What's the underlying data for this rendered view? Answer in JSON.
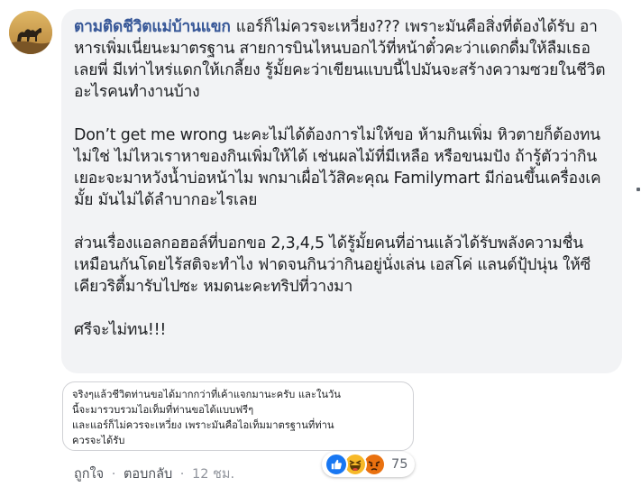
{
  "comment": {
    "author": "ตามติดชีวิตแม่บ้านแขก",
    "paragraphs": [
      "แอร์ก็ไม่ควรจะเหวี่ยง??? เพราะมันคือสิ่งที่ต้องได้รับ อาหารเพิ่มเนี่ยนะมาตรฐาน สายการบินไหนบอกไว้ที่หน้าตั๋วคะว่าแดกดื่มให้ลืมเธอเลยพี่ มีเท่าไหร่แดกให้เกลี้ยง รู้มั้ยคะว่าเขียนแบบนี้ไปมันจะสร้างความซวยในชีวิตอะไรคนทำงานบ้าง",
      "Don’t get me wrong นะคะไม่ได้ต้องการไม่ให้ขอ ห้ามกินเพิ่ม หิวตายก็ต้องทน ไม่ใช่ ไม่ไหวเราหาของกินเพิ่มให้ได้ เช่นผลไม้ที่มีเหลือ หรือขนมปัง ถ้ารู้ตัวว่ากินเยอะจะมาหวังน้ำบ่อหน้าไม พกมาเผื่อไว้สิคะคุณ Familymart มีก่อนขึ้นเครื่องเคมั้ย มันไม่ได้ลำบากอะไรเลย",
      "ส่วนเรื่องแอลกอฮอล์ที่บอกขอ 2,3,4,5 ได้รู้มั้ยคนที่อ่านแล้วได้รับพลังความชื่นเหมือนกันโดยไร้สติจะทำไง ฟาดจนกินว่ากินอยู่นั่งเล่น เอสโค่ แลนด์ปุ้ปนุ่น ให้ซีเคียวริตี้มารับไปซะ หมดนะคะทริปที่วางมา",
      "ศรีจะไม่ทน!!!"
    ],
    "quoted_lines": [
      "จริงๆแล้วชีวิตท่านขอได้มากกว่าที่เค้าแจกมานะครับ และในวัน",
      "นี้จะมารวบรวมไอเท็มที่ท่านขอได้แบบฟรีๆ",
      "และแอร์ก็ไม่ควรจะเหวี่ยง เพราะมันคือไอเท็มมาตรฐานที่ท่าน",
      "ควรจะได้รับ"
    ],
    "actions": {
      "like": "ถูกใจ",
      "reply": "ตอบกลับ",
      "separator": "·",
      "time": "12 ชม."
    },
    "reactions": {
      "icons": [
        "like-icon",
        "haha-icon",
        "angry-icon"
      ],
      "count": "75"
    }
  },
  "colors": {
    "author": "#385898",
    "bubble": "#f2f3f5",
    "like": "#1877f2",
    "haha": "#f7b928",
    "angry": "#e9710f"
  }
}
